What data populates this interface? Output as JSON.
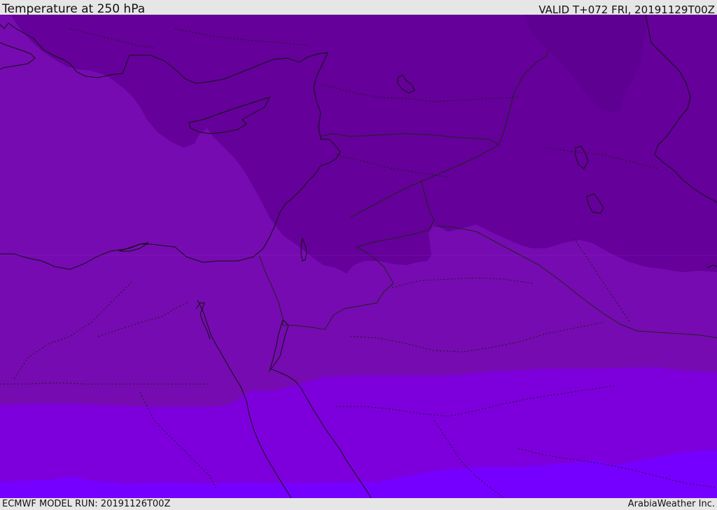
{
  "header": {
    "title": "Temperature at 250 hPa",
    "valid": "VALID T+072 FRI, 20191129T00Z"
  },
  "footer": {
    "model_run": "ECMWF MODEL RUN: 20191126T00Z",
    "credit": "ArabiaWeather Inc."
  },
  "map": {
    "colors": {
      "darkest": "#5e0092",
      "dark": "#65009a",
      "medium_dark": "#6e06a6",
      "medium": "#760bb1",
      "bright": "#7d00dc",
      "brightest": "#7600ff",
      "coastline": "#111111",
      "border": "#222222"
    }
  }
}
